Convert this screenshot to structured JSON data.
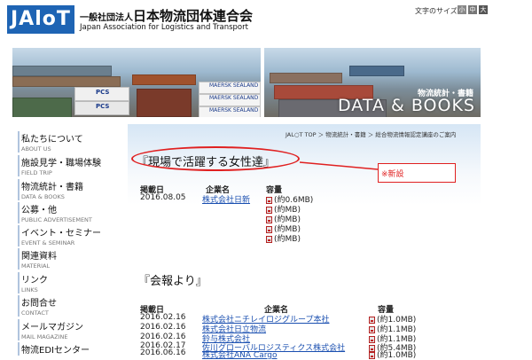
{
  "header": {
    "logo": "JAloT",
    "org_prefix": "一般社団法人",
    "org_name_jp": "日本物流団体連合会",
    "org_name_en": "Japan Association for Logistics and Transport",
    "font_size_label": "文字のサイズ",
    "font_sizes": [
      "小",
      "中",
      "大"
    ]
  },
  "banner": {
    "subtitle": "物流統計・書籍",
    "title": "DATA & BOOKS",
    "container_texts": [
      "PCS",
      "PCS",
      "MAERSK SEALAND",
      "MAERSK SEALAND",
      "MAERSK SEALAND"
    ]
  },
  "sidebar": {
    "items": [
      {
        "jp": "私たちについて",
        "en": "ABOUT US"
      },
      {
        "jp": "施設見学・職場体験",
        "en": "FIELD TRIP"
      },
      {
        "jp": "物流統計・書籍",
        "en": "DATA & BOOKS"
      },
      {
        "jp": "公募・他",
        "en": "PUBLIC ADVERTISEMENT"
      },
      {
        "jp": "イベント・セミナー",
        "en": "EVENT & SEMINAR"
      },
      {
        "jp": "関連資料",
        "en": "MATERIAL"
      },
      {
        "jp": "リンク",
        "en": "LINKS"
      },
      {
        "jp": "お問合せ",
        "en": "CONTACT"
      },
      {
        "jp": "メールマガジン",
        "en": "MAIL MAGAZINE"
      },
      {
        "jp": "物流EDIセンター",
        "en": ""
      }
    ]
  },
  "breadcrumb": "JAL○T TOP ＞ 物流統計・書籍 ＞ 総合物流情報認定講座のご案内",
  "section1": {
    "heading": "『現場で活躍する女性達』",
    "annotation": "※新設",
    "headers": {
      "date": "掲載日",
      "company": "企業名",
      "size": "容量"
    },
    "date": "2016.08.05",
    "company": "株式会社日新",
    "files": [
      "(約0.6MB)",
      "(約MB)",
      "(約MB)",
      "(約MB)",
      "(約MB)"
    ]
  },
  "section2": {
    "heading": "『会報より』",
    "headers": {
      "date": "掲載日",
      "company": "企業名",
      "size": "容量"
    },
    "rows": [
      {
        "date": "2016.02.16",
        "company": "株式会社ニチレイロジグループ本社",
        "size": "(約1.0MB)"
      },
      {
        "date": "2016.02.16",
        "company": "株式会社日立物流",
        "size": "(約1.1MB)"
      },
      {
        "date": "2016.02.16",
        "company": "鈴与株式会社",
        "size": "(約1.1MB)"
      },
      {
        "date": "2016.02.17",
        "company": "佐川グローバルロジスティクス株式会社",
        "size": "(約5.4MB)"
      },
      {
        "date": "2016.06.16",
        "company": "株式会社ANA Cargo",
        "size": "(約1.0MB)"
      }
    ]
  },
  "colors": {
    "logo_blue": "#1e64b4",
    "link": "#1a4fb0",
    "annotation_red": "#e02020"
  }
}
